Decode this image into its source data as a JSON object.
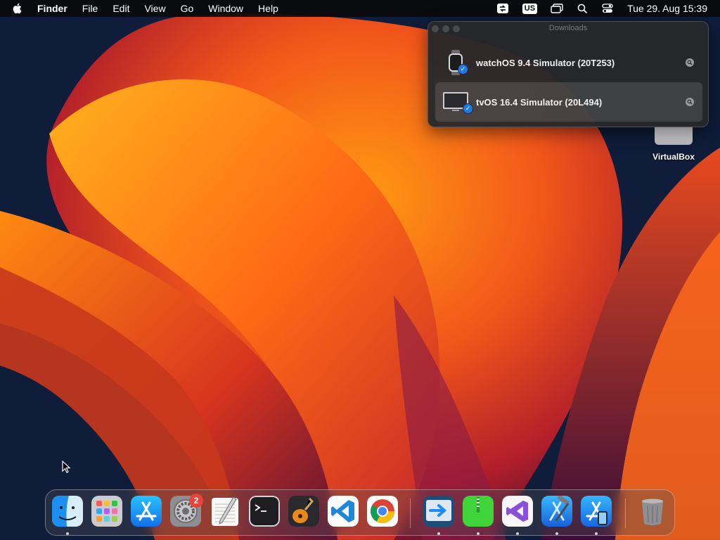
{
  "menubar": {
    "app_name": "Finder",
    "menus": [
      "File",
      "Edit",
      "View",
      "Go",
      "Window",
      "Help"
    ],
    "input_source": "US",
    "clock": "Tue 29. Aug  15:39"
  },
  "downloads_window": {
    "title": "Downloads",
    "items": [
      {
        "name": "watchOS 9.4 Simulator (20T253)",
        "icon": "watch-icon",
        "selected": false
      },
      {
        "name": "tvOS 16.4 Simulator (20L494)",
        "icon": "display-icon",
        "selected": true
      }
    ]
  },
  "desktop": {
    "icons": [
      {
        "label": "VirtualBox",
        "icon": "external-disk-icon"
      }
    ]
  },
  "dock": {
    "apps": [
      {
        "name": "finder",
        "running": true
      },
      {
        "name": "launchpad",
        "running": false
      },
      {
        "name": "app-store",
        "running": false
      },
      {
        "name": "system-settings",
        "running": false,
        "badge": "2"
      },
      {
        "name": "textedit",
        "running": false
      },
      {
        "name": "terminal",
        "running": false
      },
      {
        "name": "garageband",
        "running": false
      },
      {
        "name": "visual-studio-code",
        "running": false
      },
      {
        "name": "google-chrome",
        "running": false
      },
      {
        "name": "migration-assistant",
        "running": true
      },
      {
        "name": "archive-utility",
        "running": true
      },
      {
        "name": "visual-studio",
        "running": true
      },
      {
        "name": "xcode",
        "running": true
      },
      {
        "name": "simulator",
        "running": true
      },
      {
        "name": "trash",
        "running": false
      }
    ]
  },
  "colors": {
    "menubar_bg": "#0a0a0c",
    "window_bg": "#28282a",
    "check_blue": "#1f7ae6",
    "badge_red": "#e5453b"
  }
}
